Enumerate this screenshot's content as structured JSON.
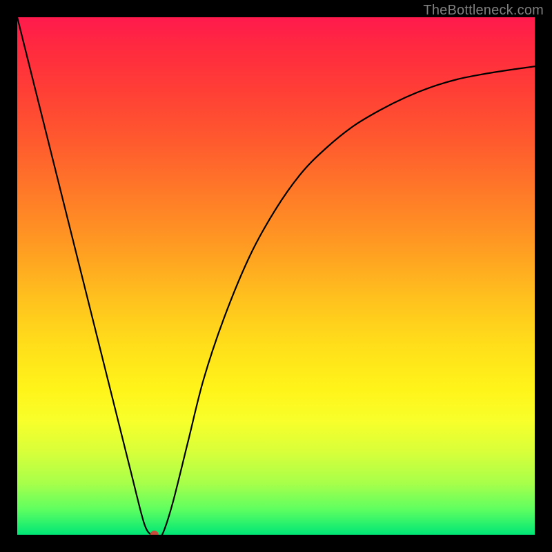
{
  "watermark": "TheBottleneck.com",
  "marker": {
    "color": "#c74a3c",
    "radius": 6
  },
  "chart_data": {
    "type": "line",
    "title": "",
    "xlabel": "",
    "ylabel": "",
    "xlim": [
      0,
      100
    ],
    "ylim": [
      0,
      100
    ],
    "grid": false,
    "legend": false,
    "series": [
      {
        "name": "curve",
        "x": [
          0,
          5,
          10,
          15,
          20,
          22,
          24,
          25,
          26,
          27,
          28,
          30,
          33,
          36,
          40,
          45,
          50,
          55,
          60,
          65,
          70,
          75,
          80,
          85,
          90,
          95,
          100
        ],
        "y": [
          100,
          80,
          60,
          40,
          20,
          12,
          4,
          1,
          0,
          0,
          0,
          6,
          18,
          30,
          42,
          54,
          63,
          70,
          75,
          79,
          82,
          84.5,
          86.5,
          88,
          89,
          89.8,
          90.5
        ]
      }
    ],
    "annotations": [
      {
        "type": "marker",
        "x": 26.5,
        "y": 0
      }
    ],
    "background_gradient": {
      "direction": "vertical",
      "stops": [
        {
          "pos": 0,
          "color": "#ff1a4d"
        },
        {
          "pos": 50,
          "color": "#ffb020"
        },
        {
          "pos": 75,
          "color": "#fff41a"
        },
        {
          "pos": 100,
          "color": "#00e676"
        }
      ]
    }
  }
}
